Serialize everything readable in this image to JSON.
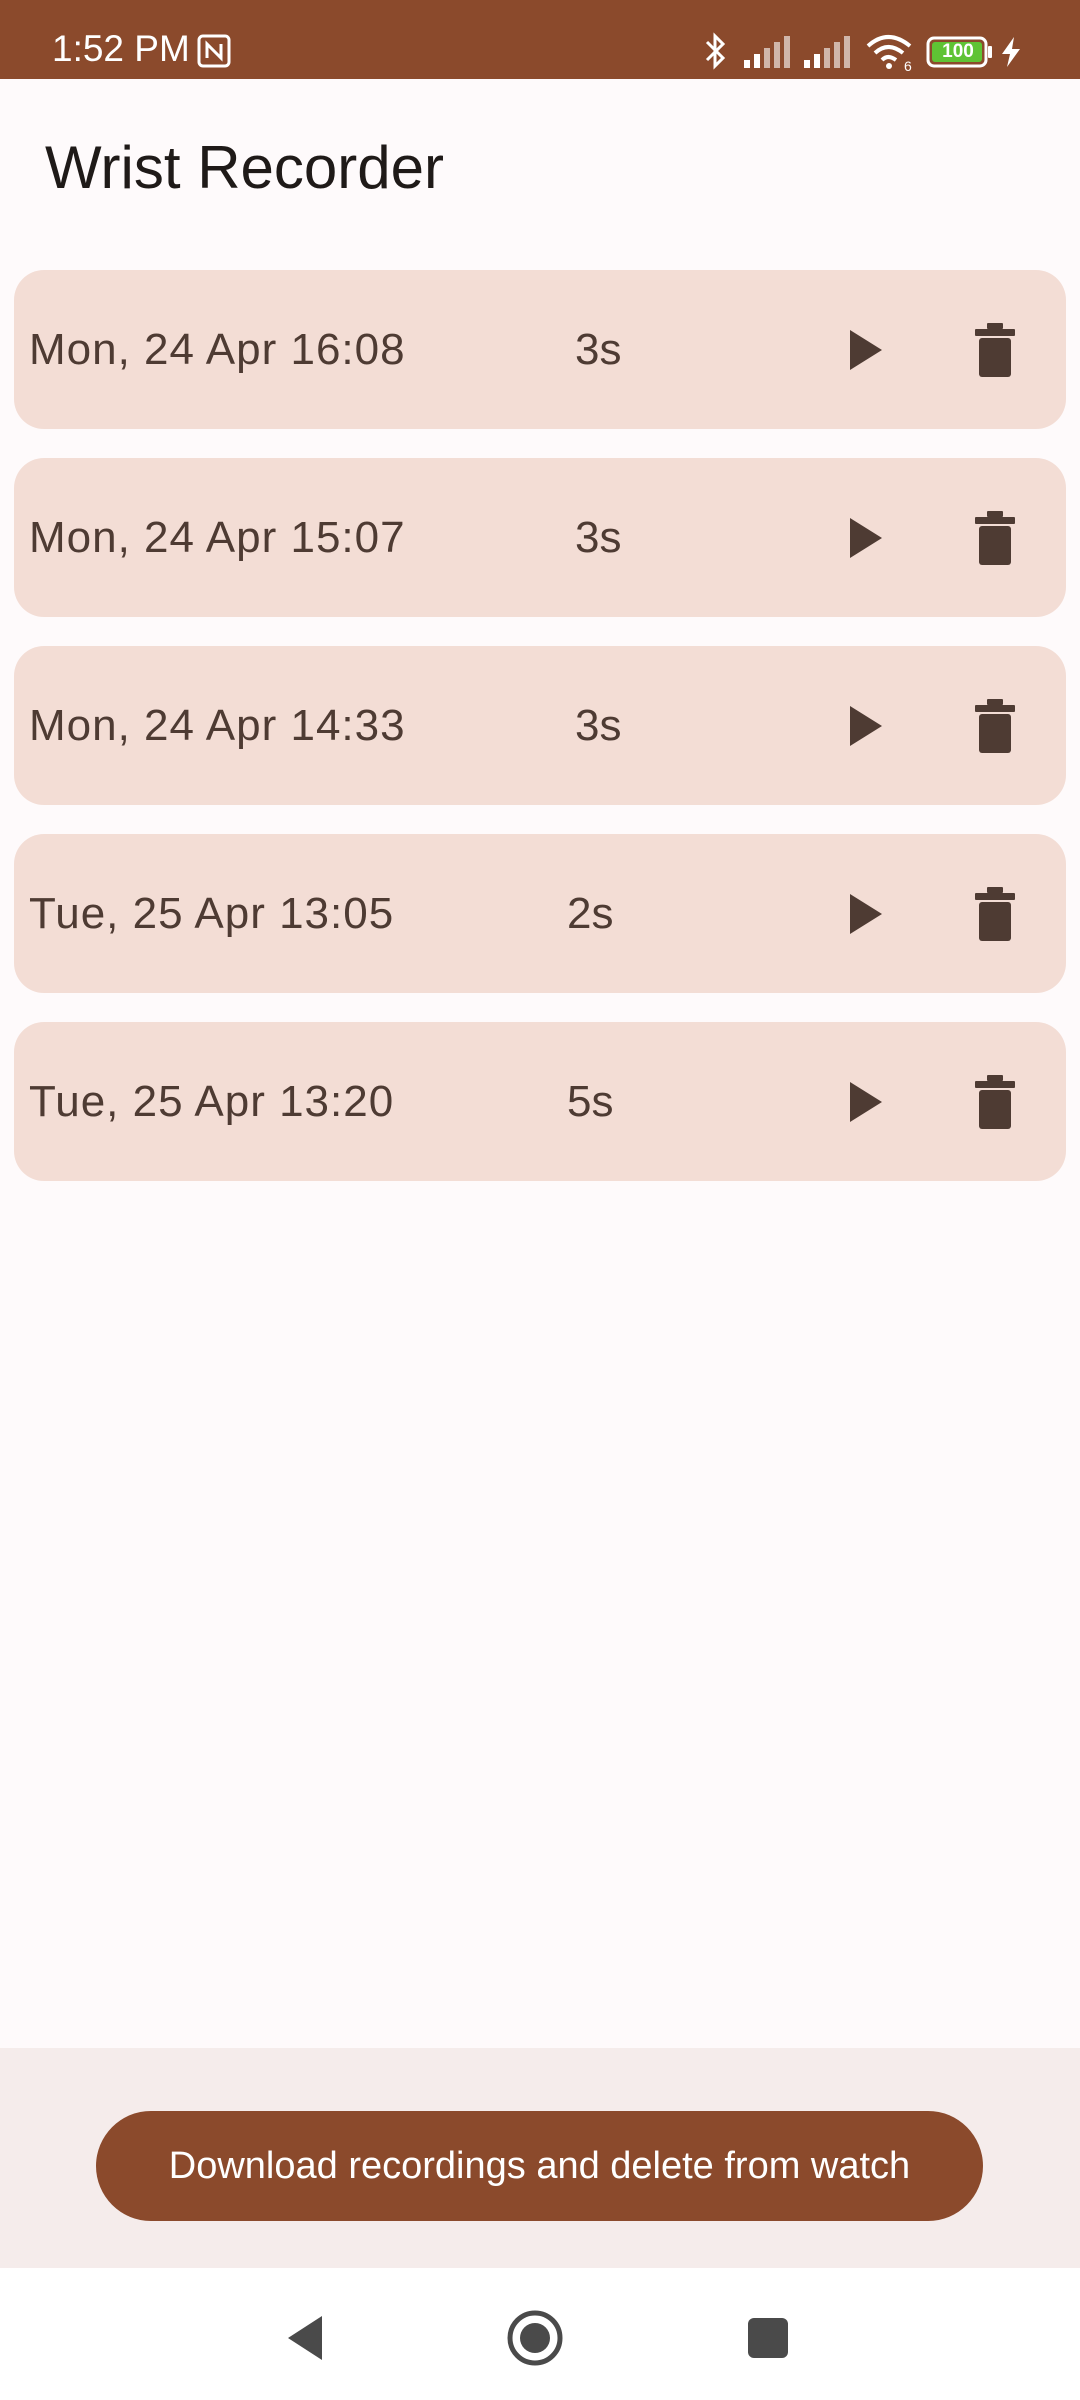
{
  "status_bar": {
    "time": "1:52 PM",
    "battery": "100",
    "network_label": "6",
    "icons": [
      "nfc-icon",
      "bluetooth-icon",
      "signal-icon",
      "signal-icon",
      "wifi-icon",
      "battery-icon",
      "charging-icon"
    ]
  },
  "app": {
    "title": "Wrist Recorder"
  },
  "recordings": [
    {
      "date": "Mon, 24 Apr 16:08",
      "duration": "3s"
    },
    {
      "date": "Mon, 24 Apr 15:07",
      "duration": "3s"
    },
    {
      "date": "Mon, 24 Apr 14:33",
      "duration": "3s"
    },
    {
      "date": "Tue, 25 Apr 13:05",
      "duration": "2s"
    },
    {
      "date": "Tue, 25 Apr 13:20",
      "duration": "5s"
    }
  ],
  "actions": {
    "download_label": "Download recordings and delete from watch"
  },
  "colors": {
    "brand": "#8b4a2c",
    "row_bg": "#f3ddd5",
    "icon": "#4e3b33"
  },
  "nav": {
    "icons": [
      "back-icon",
      "home-icon",
      "recents-icon"
    ]
  }
}
